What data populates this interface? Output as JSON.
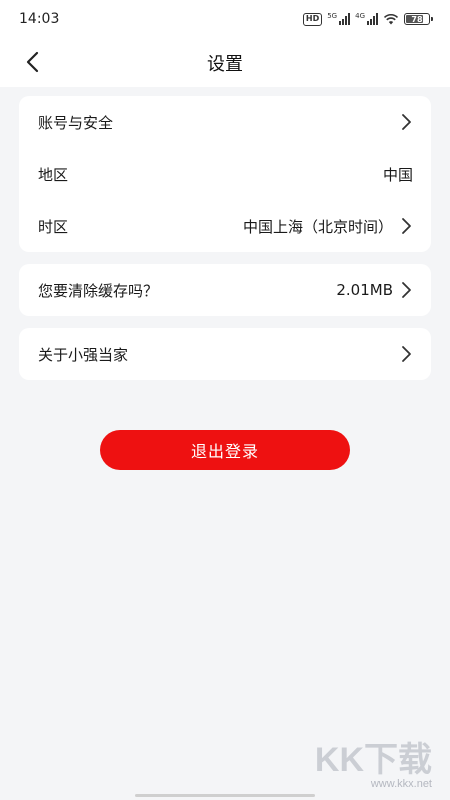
{
  "status_bar": {
    "time": "14:03",
    "hd_label": "HD",
    "signal_1_label": "5G",
    "signal_2_label": "4G",
    "battery_level": "78"
  },
  "nav": {
    "title": "设置",
    "back_icon": "chevron-left-icon"
  },
  "account_section": {
    "account_security_label": "账号与安全",
    "region_label": "地区",
    "region_value": "中国",
    "timezone_label": "时区",
    "timezone_value": "中国上海（北京时间）"
  },
  "cache_section": {
    "label": "您要清除缓存吗？",
    "value": "2.01MB"
  },
  "about_section": {
    "label": "关于小强当家"
  },
  "logout": {
    "label": "退出登录",
    "color": "#ee1111"
  },
  "watermark": {
    "logo": "KK下载",
    "url": "www.kkx.net"
  }
}
